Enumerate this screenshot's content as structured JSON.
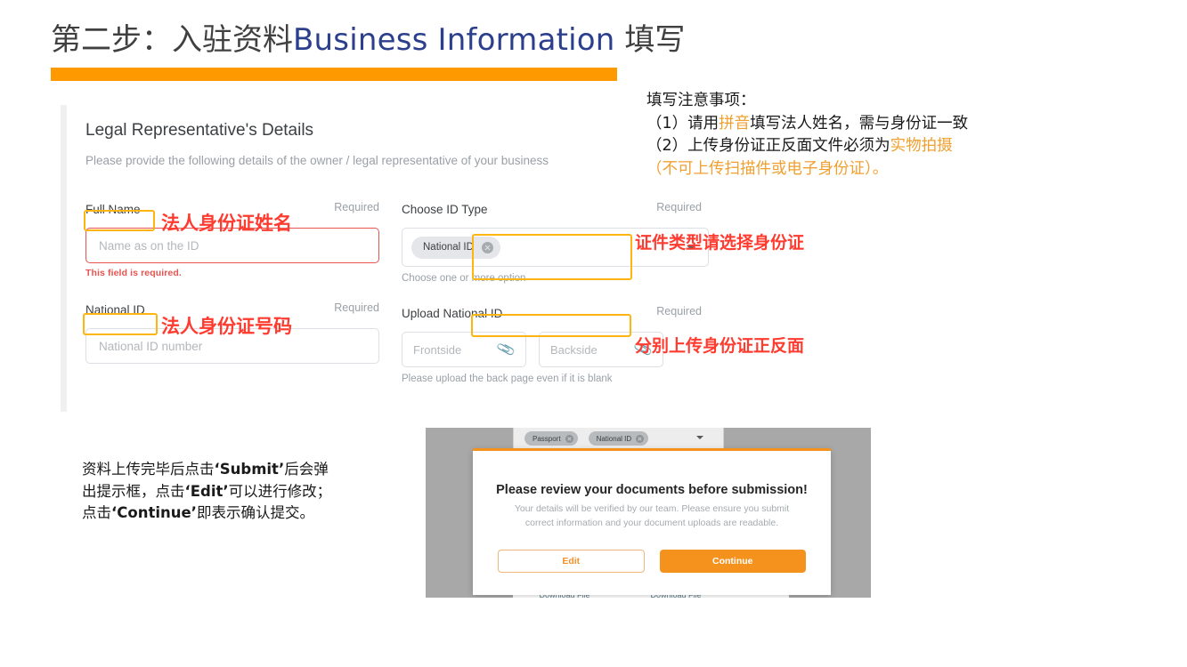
{
  "slide": {
    "title_cn_prefix": "第二步：入驻资料",
    "title_en": "Business Information",
    "title_cn_suffix": " 填写",
    "accent_orange": "#ff9900",
    "title_blue": "#2b3f8c"
  },
  "form": {
    "section_title": "Legal Representative's Details",
    "section_subtitle": "Please provide the following details of the owner / legal representative of your business",
    "required_label": "Required",
    "fields": {
      "full_name": {
        "label": "Full Name",
        "placeholder": "Name as on the ID",
        "value": "",
        "error": "This field is required.",
        "required": "Required"
      },
      "national_id": {
        "label": "National ID",
        "placeholder": "National ID number",
        "value": "",
        "required": "Required"
      },
      "choose_id_type": {
        "label": "Choose ID Type",
        "required": "Required",
        "selected_chips": [
          "National ID"
        ],
        "hint": "Choose one or more option"
      },
      "upload_national_id": {
        "label": "Upload National ID",
        "required": "Required",
        "frontside_placeholder": "Frontside",
        "backside_placeholder": "Backside",
        "hint": "Please upload the back page even if it is blank"
      }
    }
  },
  "annotations": {
    "highlight_color": "#ffb511",
    "red_color": "#ff3b30",
    "red_notes": {
      "full_name": "法人身份证姓名",
      "national_id": "法人身份证号码",
      "id_type": "证件类型请选择身份证",
      "upload": "分别上传身份证正反面"
    },
    "top_note": {
      "heading": "填写注意事项：",
      "line1_a": "（1）请用",
      "line1_hi": "拼音",
      "line1_b": "填写法人姓名，需与身份证一致",
      "line2_a": "（2）上传身份证正反面文件必须为",
      "line2_hi": "实物拍摄",
      "line3_hi": "（不可上传扫描件或电子身份证）。"
    },
    "bottom_note": {
      "line1_a": "资料上传完毕后点击",
      "line1_b": "‘Submit’",
      "line1_c": "后会弹",
      "line2_a": "出提示框，点击",
      "line2_b": "‘Edit’",
      "line2_c": "可以进行修改；",
      "line3_a": "点击",
      "line3_b": "‘Continue’",
      "line3_c": "即表示确认提交。"
    }
  },
  "modal_screenshot": {
    "chips": [
      "Passport",
      "National ID"
    ],
    "title": "Please review your documents before submission!",
    "body": "Your details will be verified by our team. Please ensure you submit correct information and your document uploads are readable.",
    "edit_button": "Edit",
    "continue_button": "Continue",
    "download_left": "Download File",
    "download_right": "Download File",
    "button_orange": "#f5921e"
  }
}
